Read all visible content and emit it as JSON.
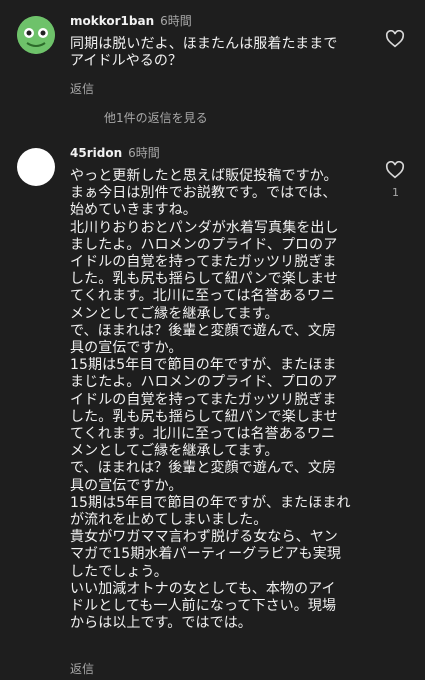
{
  "comments": [
    {
      "username": "mokkor1ban",
      "time": "6時間",
      "text": "同期は脱いだよ、ほまたんは服着たままで\nアイドルやるの？",
      "reply_label": "返信",
      "view_replies": "他1件の返信を見る"
    },
    {
      "username": "45ridon",
      "time": "6時間",
      "text": "やっと更新したと思えば販促投稿ですか。\nまぁ今日は別件でお説教です。ではでは、\n始めていきますね。\n北川りおりおとパンダが水着写真集を出し\nましたよ。ハロメンのプライド、プロのア\nイドルの自覚を持ってまたガッツリ脱ぎま\nした。乳も尻も揺らして紐パンで楽しませ\nてくれます。北川に至っては名誉あるワニ\nメンとしてご縁を継承してます。\nで、ほまれは？後輩と変顔で遊んで、文房\n具の宣伝ですか。\n15期は5年目で節目の年ですが、またほま\nまじたよ。ハロメンのプライド、プロのア\nイドルの自覚を持ってまたガッツリ脱ぎま\nした。乳も尻も揺らして紐パンで楽しませ\nてくれます。北川に至っては名誉あるワニ\nメンとしてご縁を継承してます。\nで、ほまれは？後輩と変顔で遊んで、文房\n具の宣伝ですか。\n15期は5年目で節目の年ですが、またほまれ\nが流れを止めてしまいました。\n貴女がワガママ言わず脱げる女なら、ヤン\nマガで15期水着パーティーグラビアも実現\nしたでしょう。\nいい加減オトナの女としても、本物のアイ\nドルとしても一人前になって下さい。現場\nからは以上です。ではでは。",
      "like_count": "1",
      "reply_label": "返信"
    }
  ]
}
